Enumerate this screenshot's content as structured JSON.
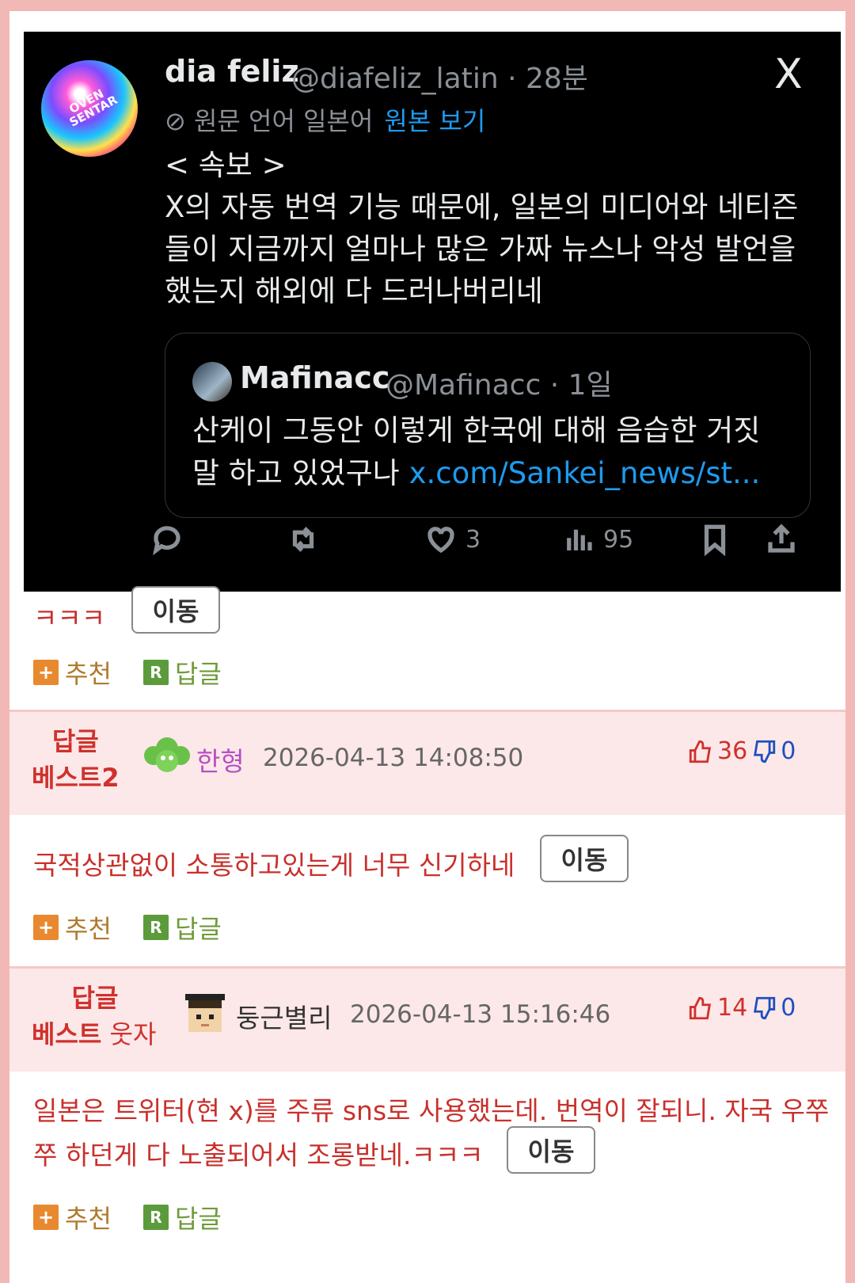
{
  "tweet": {
    "name": "dia feliz",
    "handle_time": "@diafeliz_latin · 28분",
    "close_icon": "X",
    "avatar_text": "OVEN SENTAR",
    "lang_note": "원문 언어 일본어",
    "lang_link": "원본 보기",
    "body_lines": [
      "< 속보 >",
      "X의 자동 번역 기능 때문에, 일본의 미디어와 네티즌",
      "들이 지금까지 얼마나 많은 가짜 뉴스나 악성 발언을",
      "했는지 해외에 다 드러나버리네"
    ],
    "quote": {
      "name": "Mafinacc",
      "handle_time": "@Mafinacc · 1일",
      "line1": "산케이 그동안 이렇게 한국에 대해 음습한 거짓",
      "line2_text": "말 하고 있었구나 ",
      "line2_link": "x.com/Sankei_news/st..."
    },
    "actions": {
      "reply_icon": "reply-icon",
      "retweet_icon": "retweet-icon",
      "like_count": "3",
      "views_count": "95",
      "bookmark_icon": "bookmark-icon",
      "share_icon": "share-icon"
    }
  },
  "post": {
    "text": "ㅋㅋㅋ",
    "move_label": "이동",
    "recommend_label": "추천",
    "reply_label": "답글"
  },
  "comments": [
    {
      "badge_line1": "답글",
      "badge_line2": "베스트2",
      "badge_extra": "",
      "nickname": "한형",
      "nick_color": "#b84fc4",
      "datetime": "2026-04-13 14:08:50",
      "up": "36",
      "down": "0",
      "text": "국적상관없이 소통하고있는게 너무 신기하네",
      "move_label": "이동",
      "recommend_label": "추천",
      "reply_label": "답글"
    },
    {
      "badge_line1": "답글",
      "badge_line2": "베스트",
      "badge_extra": " 웃자",
      "nickname": "둥근별리",
      "nick_color": "#333333",
      "datetime": "2026-04-13 15:16:46",
      "up": "14",
      "down": "0",
      "text_line1": "일본은 트위터(현 x)를 주류 sns로 사용했는데. 번역이 잘되니. 자국 우쭈",
      "text_line2": "쭈 하던게 다 노출되어서 조롱받네.ㅋㅋㅋ",
      "move_label": "이동",
      "recommend_label": "추천",
      "reply_label": "답글"
    }
  ],
  "colors": {
    "page_border": "#f2b8b5",
    "comment_text": "#c9302c",
    "best_bg": "#fce8e8",
    "link_blue": "#1d9bf0"
  }
}
